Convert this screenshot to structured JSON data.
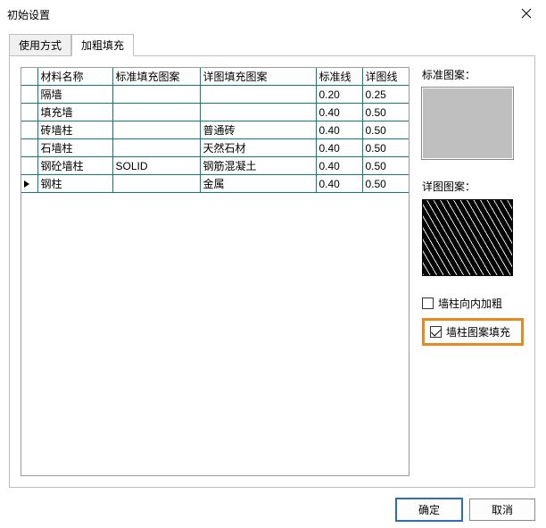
{
  "window": {
    "title": "初始设置"
  },
  "tabs": [
    {
      "label": "使用方式",
      "active": false
    },
    {
      "label": "加粗填充",
      "active": true
    }
  ],
  "table": {
    "headers": [
      "材料名称",
      "标准填充图案",
      "详图填充图案",
      "标准线",
      "详图线"
    ],
    "rows": [
      {
        "c0": "隔墙",
        "c1": "",
        "c2": "",
        "c3": "0.20",
        "c4": "0.25"
      },
      {
        "c0": "填充墙",
        "c1": "",
        "c2": "",
        "c3": "0.40",
        "c4": "0.50"
      },
      {
        "c0": "砖墙柱",
        "c1": "",
        "c2": "普通砖",
        "c3": "0.40",
        "c4": "0.50"
      },
      {
        "c0": "石墙柱",
        "c1": "",
        "c2": "天然石材",
        "c3": "0.40",
        "c4": "0.50"
      },
      {
        "c0": "钢砼墙柱",
        "c1": "SOLID",
        "c2": "钢筋混凝土",
        "c3": "0.40",
        "c4": "0.50"
      },
      {
        "c0": "钢柱",
        "c1": "",
        "c2": "金属",
        "c3": "0.40",
        "c4": "0.50",
        "current": true
      }
    ]
  },
  "side": {
    "std_label": "标准图案：",
    "detail_label": "详图图案：",
    "chk_inner_bold": {
      "label": "墙柱向内加粗",
      "checked": false
    },
    "chk_pattern_fill": {
      "label": "墙柱图案填充",
      "checked": true
    }
  },
  "buttons": {
    "ok": "确定",
    "cancel": "取消"
  }
}
